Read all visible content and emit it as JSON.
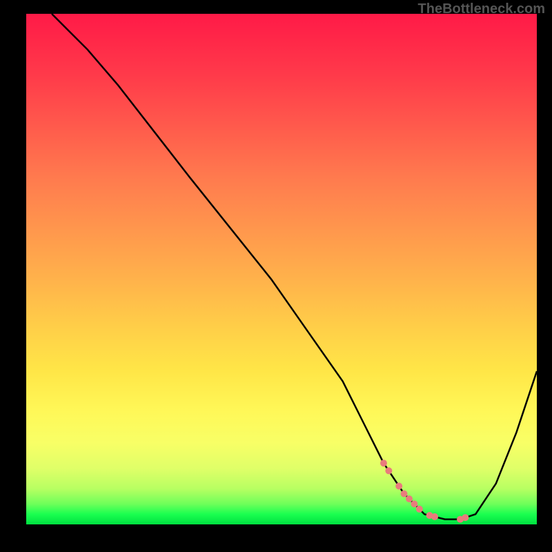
{
  "watermark": "TheBottleneck.com",
  "chart_data": {
    "type": "line",
    "title": "",
    "xlabel": "",
    "ylabel": "",
    "xlim": [
      0,
      100
    ],
    "ylim": [
      0,
      100
    ],
    "series": [
      {
        "name": "curve",
        "x": [
          5,
          8,
          12,
          18,
          25,
          32,
          40,
          48,
          55,
          62,
          66,
          70,
          74,
          78,
          82,
          85,
          88,
          92,
          96,
          100
        ],
        "values": [
          100,
          97,
          93,
          86,
          77,
          68,
          58,
          48,
          38,
          28,
          20,
          12,
          6,
          2,
          1,
          1,
          2,
          8,
          18,
          30
        ]
      }
    ],
    "highlight_range_x": [
      70,
      86
    ],
    "colors": {
      "curve": "#000000",
      "highlight_dots": "#e97c7c",
      "background_gradient": [
        "#ff1a47",
        "#00e040"
      ]
    }
  }
}
